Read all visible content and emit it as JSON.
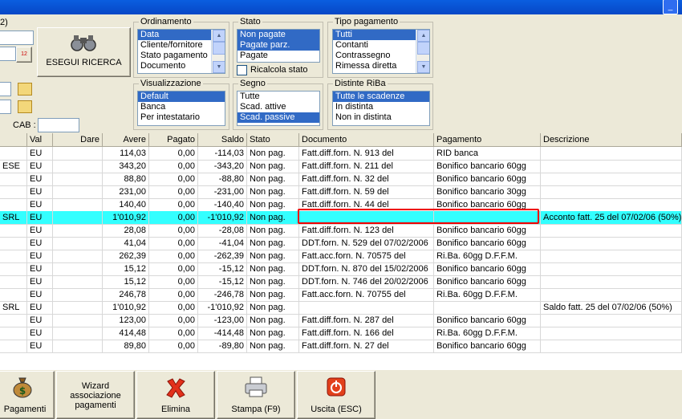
{
  "window": {
    "title_button": "_",
    "partial_label": "2)"
  },
  "search": {
    "button_label": "ESEGUI RICERCA",
    "date_button": "12",
    "cab_label": "CAB :"
  },
  "filters": {
    "ordinamento": {
      "title": "Ordinamento",
      "items": [
        "Data",
        "Cliente/fornitore",
        "Stato pagamento",
        "Documento"
      ],
      "selected": [
        0
      ]
    },
    "stato": {
      "title": "Stato",
      "items": [
        "Non pagate",
        "Pagate parz.",
        "Pagate"
      ],
      "selected": [
        0,
        1
      ],
      "checkbox_label": "Ricalcola stato"
    },
    "tipo_pagamento": {
      "title": "Tipo pagamento",
      "items": [
        "Tutti",
        "Contanti",
        "Contrassegno",
        "Rimessa diretta"
      ],
      "selected": [
        0
      ]
    },
    "visualizzazione": {
      "title": "Visualizzazione",
      "items": [
        "Default",
        "Banca",
        "Per intestatario"
      ],
      "selected": [
        0
      ]
    },
    "segno": {
      "title": "Segno",
      "items": [
        "Tutte",
        "Scad. attive",
        "Scad. passive"
      ],
      "selected": [
        2
      ]
    },
    "distinte_riba": {
      "title": "Distinte RiBa",
      "items": [
        "Tutte le scadenze",
        "In distinta",
        "Non in distinta"
      ],
      "selected": [
        0
      ]
    }
  },
  "table": {
    "columns": [
      "",
      "Val",
      "Dare",
      "Avere",
      "Pagato",
      "Saldo",
      "Stato",
      "Documento",
      "Pagamento",
      "Descrizione"
    ],
    "rows": [
      [
        "",
        "EU",
        "",
        "114,03",
        "0,00",
        "-114,03",
        "Non pag.",
        "Fatt.diff.forn. N. 913 del",
        "RID banca",
        ""
      ],
      [
        "ESE",
        "EU",
        "",
        "343,20",
        "0,00",
        "-343,20",
        "Non pag.",
        "Fatt.diff.forn. N. 211 del",
        "Bonifico bancario 60gg",
        ""
      ],
      [
        "",
        "EU",
        "",
        "88,80",
        "0,00",
        "-88,80",
        "Non pag.",
        "Fatt.diff.forn. N. 32 del",
        "Bonifico bancario 60gg",
        ""
      ],
      [
        "",
        "EU",
        "",
        "231,00",
        "0,00",
        "-231,00",
        "Non pag.",
        "Fatt.diff.forn. N. 59 del",
        "Bonifico bancario 30gg",
        ""
      ],
      [
        "",
        "EU",
        "",
        "140,40",
        "0,00",
        "-140,40",
        "Non pag.",
        "Fatt.diff.forn. N. 44 del",
        "Bonifico bancario 60gg",
        ""
      ],
      [
        "SRL",
        "EU",
        "",
        "1'010,92",
        "0,00",
        "-1'010,92",
        "Non pag.",
        "",
        "",
        "Acconto fatt. 25 del 07/02/06 (50%)"
      ],
      [
        "",
        "EU",
        "",
        "28,08",
        "0,00",
        "-28,08",
        "Non pag.",
        "Fatt.diff.forn. N. 123 del",
        "Bonifico bancario 60gg",
        ""
      ],
      [
        "",
        "EU",
        "",
        "41,04",
        "0,00",
        "-41,04",
        "Non pag.",
        "DDT.forn. N. 529 del 07/02/2006",
        "Bonifico bancario 60gg",
        ""
      ],
      [
        "",
        "EU",
        "",
        "262,39",
        "0,00",
        "-262,39",
        "Non pag.",
        "Fatt.acc.forn. N. 70575 del",
        "Ri.Ba. 60gg D.F.F.M.",
        ""
      ],
      [
        "",
        "EU",
        "",
        "15,12",
        "0,00",
        "-15,12",
        "Non pag.",
        "DDT.forn. N. 870 del 15/02/2006",
        "Bonifico bancario 60gg",
        ""
      ],
      [
        "",
        "EU",
        "",
        "15,12",
        "0,00",
        "-15,12",
        "Non pag.",
        "DDT.forn. N. 746 del 20/02/2006",
        "Bonifico bancario 60gg",
        ""
      ],
      [
        "",
        "EU",
        "",
        "246,78",
        "0,00",
        "-246,78",
        "Non pag.",
        "Fatt.acc.forn. N. 70755 del",
        "Ri.Ba. 60gg D.F.F.M.",
        ""
      ],
      [
        "SRL",
        "EU",
        "",
        "1'010,92",
        "0,00",
        "-1'010,92",
        "Non pag.",
        "",
        "",
        "Saldo fatt. 25 del 07/02/06 (50%)"
      ],
      [
        "",
        "EU",
        "",
        "123,00",
        "0,00",
        "-123,00",
        "Non pag.",
        "Fatt.diff.forn. N. 287 del",
        "Bonifico bancario 60gg",
        ""
      ],
      [
        "",
        "EU",
        "",
        "414,48",
        "0,00",
        "-414,48",
        "Non pag.",
        "Fatt.diff.forn. N. 166 del",
        "Ri.Ba. 60gg D.F.F.M.",
        ""
      ],
      [
        "",
        "EU",
        "",
        "89,80",
        "0,00",
        "-89,80",
        "Non pag.",
        "Fatt.diff.forn. N. 27 del",
        "Bonifico bancario 60gg",
        ""
      ]
    ],
    "highlight_row": 5,
    "highlight_color": "#33ffff"
  },
  "toolbar": {
    "pagamenti": "Pagamenti",
    "wizard_line1": "Wizard",
    "wizard_line2": "associazione",
    "wizard_line3": "pagamenti",
    "elimina": "Elimina",
    "stampa": "Stampa (F9)",
    "uscita": "Uscita (ESC)"
  },
  "colors": {
    "selection": "#316ac5",
    "highlight_row": "#33ffff",
    "annotation_box": "#ee0000",
    "titlebar": "#0a5ee0"
  },
  "icons": [
    "binoculars-icon",
    "calendar-icon",
    "folder-icon",
    "money-bag-icon",
    "delete-x-icon",
    "printer-icon",
    "power-icon"
  ]
}
